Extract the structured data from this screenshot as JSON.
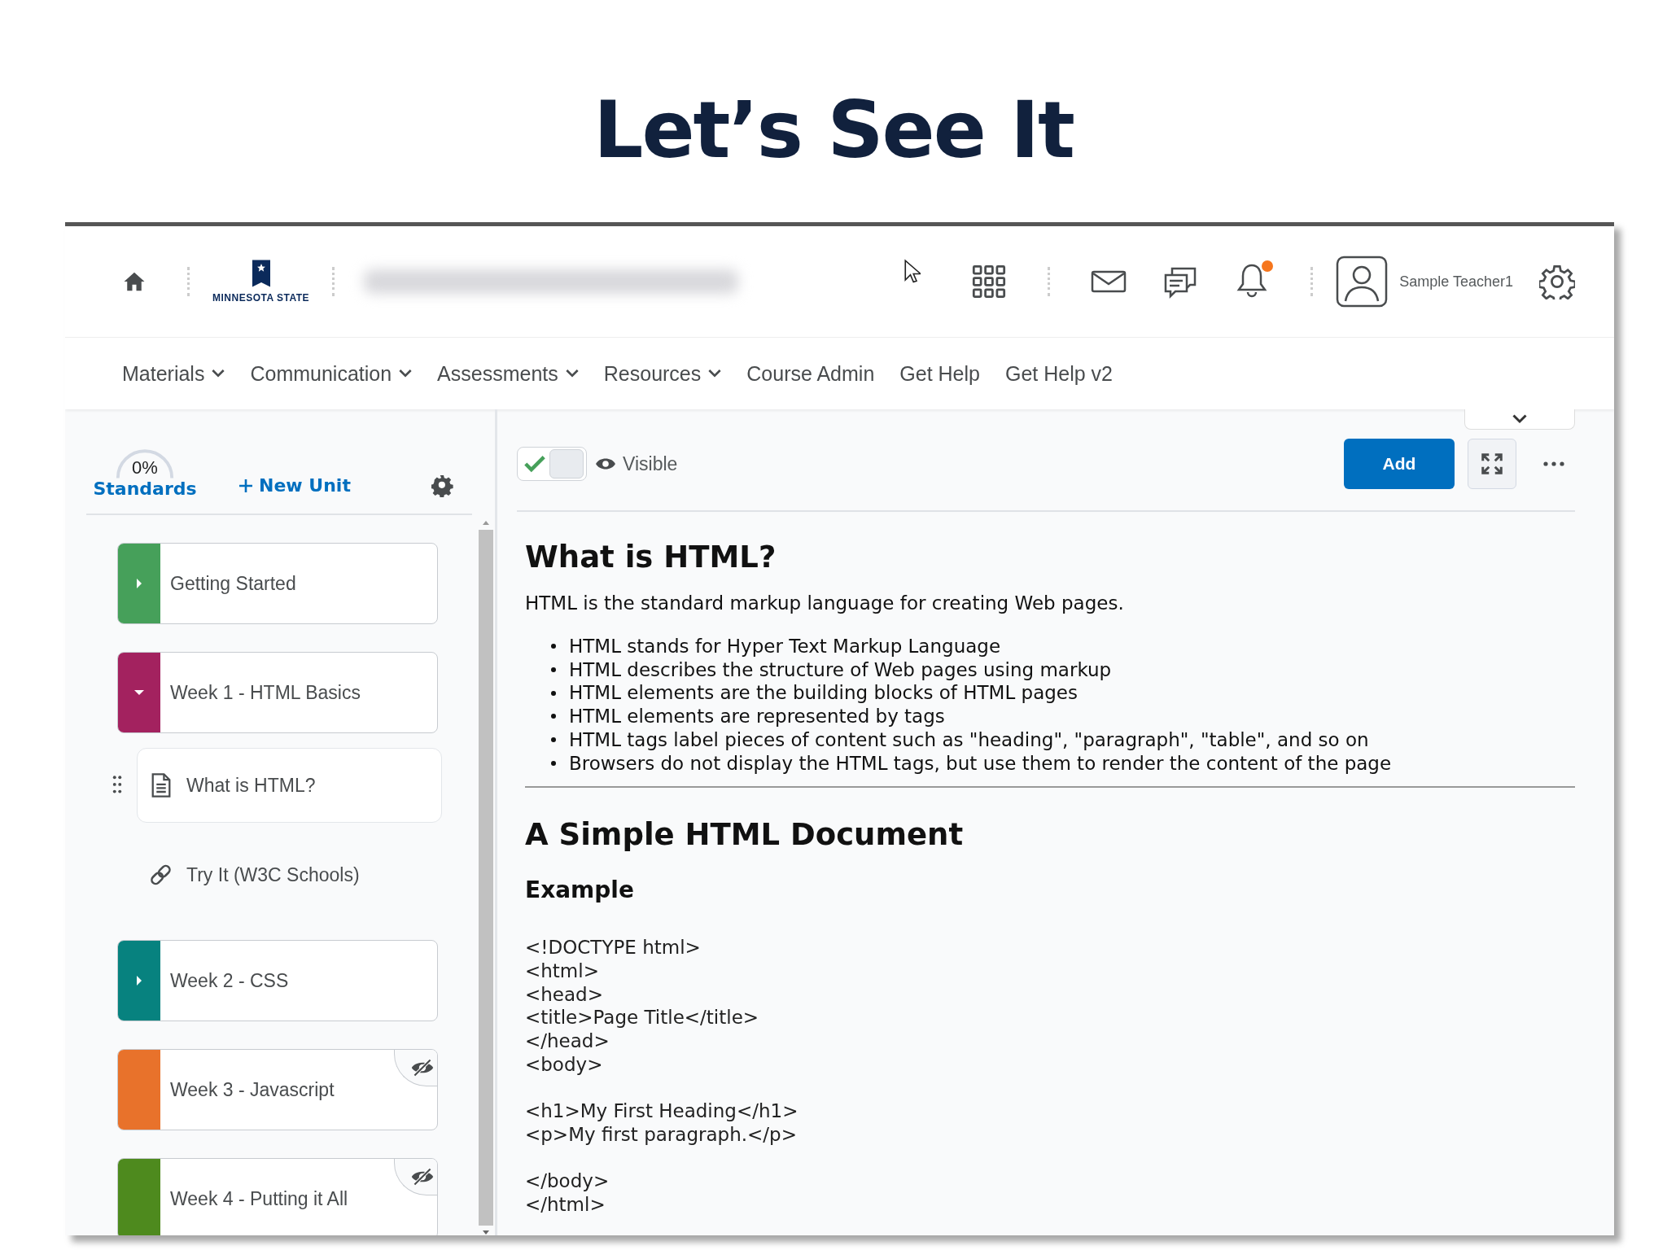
{
  "slide_title": "Let’s See It",
  "header": {
    "logo_text": "MINNESOTA STATE",
    "user_name": "Sample Teacher1",
    "notification": true
  },
  "nav": [
    {
      "label": "Materials",
      "dropdown": true
    },
    {
      "label": "Communication",
      "dropdown": true
    },
    {
      "label": "Assessments",
      "dropdown": true
    },
    {
      "label": "Resources",
      "dropdown": true
    },
    {
      "label": "Course Admin",
      "dropdown": false
    },
    {
      "label": "Get Help",
      "dropdown": false
    },
    {
      "label": "Get Help v2",
      "dropdown": false
    }
  ],
  "sidebar": {
    "progress": {
      "value": "0%",
      "label": "Standards"
    },
    "new_unit": "New Unit",
    "units": [
      {
        "title": "Getting Started",
        "color": "#46a05a",
        "expanded": false,
        "hidden": false
      },
      {
        "title": "Week 1 - HTML Basics",
        "color": "#a3225f",
        "expanded": true,
        "hidden": false,
        "children": [
          {
            "kind": "page",
            "title": "What is HTML?",
            "selected": true
          },
          {
            "kind": "link",
            "title": "Try It (W3C Schools)",
            "selected": false
          }
        ]
      },
      {
        "title": "Week 2 - CSS",
        "color": "#07827f",
        "expanded": false,
        "hidden": false
      },
      {
        "title": "Week 3 - Javascript",
        "color": "#e8722b",
        "hidden": true
      },
      {
        "title": "Week 4 - Putting it All",
        "color": "#4e8a1e",
        "hidden": true
      }
    ]
  },
  "toolbar": {
    "visible": {
      "checked": true,
      "label": "Visible"
    },
    "add_button": "Add"
  },
  "content": {
    "heading": "What is HTML?",
    "intro": "HTML is the standard markup language for creating Web pages.",
    "bullets": [
      "HTML stands for Hyper Text Markup Language",
      "HTML describes the structure of Web pages using markup",
      "HTML elements are the building blocks of HTML pages",
      "HTML elements are represented by tags",
      "HTML tags label pieces of content such as \"heading\", \"paragraph\", \"table\", and so on",
      "Browsers do not display the HTML tags, but use them to render the content of the page"
    ],
    "heading2": "A Simple HTML Document",
    "subheading": "Example",
    "code_blocks": [
      [
        "<!DOCTYPE html>",
        "<html>",
        "<head>",
        "<title>Page Title</title>",
        "</head>",
        "<body>"
      ],
      [
        "<h1>My First Heading</h1>",
        "<p>My first paragraph.</p>"
      ],
      [
        "</body>",
        "</html>"
      ]
    ]
  }
}
